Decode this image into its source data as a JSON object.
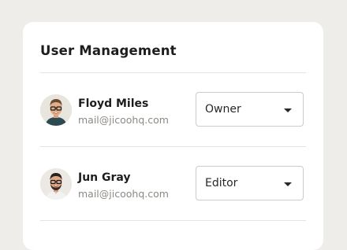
{
  "card": {
    "title": "User Management"
  },
  "users": [
    {
      "name": "Floyd Miles",
      "email": "mail@jicoohq.com",
      "role": "Owner",
      "avatar": "avatar-man-glasses-icon"
    },
    {
      "name": "Jun Gray",
      "email": "mail@jicoohq.com",
      "role": "Editor",
      "avatar": "avatar-man-beard-icon"
    }
  ],
  "colors": {
    "background": "#efedea",
    "card": "#ffffff",
    "text_primary": "#1f1d1b",
    "text_secondary": "#8d8984",
    "divider": "#e6e3df",
    "select_border": "#cfcbc6"
  }
}
